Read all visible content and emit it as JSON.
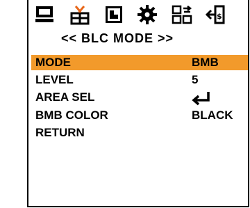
{
  "toolbar": {
    "icons": [
      "monitor-icon",
      "camera-settings-icon",
      "image-adjust-icon",
      "gear-icon",
      "network-transfer-icon",
      "exit-icon"
    ]
  },
  "menu": {
    "title": "<< BLC MODE >>",
    "items": [
      {
        "label": "MODE",
        "value": "BMB",
        "selected": true
      },
      {
        "label": "LEVEL",
        "value": "5"
      },
      {
        "label": "AREA SEL",
        "value": "",
        "value_icon": "enter-arrow-icon"
      },
      {
        "label": "BMB COLOR",
        "value": "BLACK"
      },
      {
        "label": "RETURN",
        "value": ""
      }
    ]
  },
  "colors": {
    "highlight": "#f29a2b",
    "text": "#000000",
    "background": "#ffffff"
  }
}
